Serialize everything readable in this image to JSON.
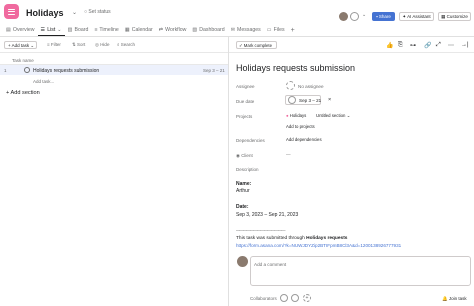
{
  "header": {
    "title": "Holidays",
    "status_label": "Set status",
    "share_label": "Share",
    "ai_label": "AI Assistant",
    "customize_label": "Customize"
  },
  "tabs": [
    {
      "label": "Overview"
    },
    {
      "label": "List"
    },
    {
      "label": "Board"
    },
    {
      "label": "Timeline"
    },
    {
      "label": "Calendar"
    },
    {
      "label": "Workflow"
    },
    {
      "label": "Dashboard"
    },
    {
      "label": "Messages"
    },
    {
      "label": "Files"
    }
  ],
  "toolbar": {
    "add_task_label": "Add task",
    "filter_label": "Filter",
    "sort_label": "Sort",
    "hide_label": "Hide",
    "search_label": "Search"
  },
  "list": {
    "column_header": "Task name",
    "row": {
      "number": "1",
      "title": "Holidays requests submission",
      "date": "Sep 3 – 21"
    },
    "add_task_label": "Add task...",
    "add_section_label": "Add section"
  },
  "detail": {
    "mark_complete_label": "Mark complete",
    "task_title": "Holidays requests submission",
    "fields": {
      "assignee_label": "Assignee",
      "assignee_value": "No assignee",
      "due_label": "Due date",
      "due_value": "Sep 3 – 21",
      "projects_label": "Projects",
      "project_name": "Holidays",
      "section_name": "Untitled section",
      "add_to_projects": "Add to projects",
      "dependencies_label": "Dependencies",
      "add_dependencies": "Add dependencies",
      "client_label": "Client",
      "client_value": "—",
      "description_label": "Description"
    },
    "description": {
      "name_label": "Name:",
      "name_value": "Arthur",
      "date_label": "Date:",
      "date_value": "Sep 3, 2023 – Sep 21, 2023",
      "separator": "——————————————",
      "submitted_prefix": "This task was submitted through",
      "submitted_form": "Holidays requests",
      "form_url": "https://form.asana.com/?k=NUWJDYZip2BTIFpmB8Cl3A&d=1200138926777931"
    },
    "comment_placeholder": "Add a comment",
    "collaborators_label": "Collaborators",
    "join_label": "Join task"
  },
  "colors": {
    "accent": "#4573d2",
    "app_icon": "#f06a9f",
    "selected_row": "#edf1fc"
  }
}
